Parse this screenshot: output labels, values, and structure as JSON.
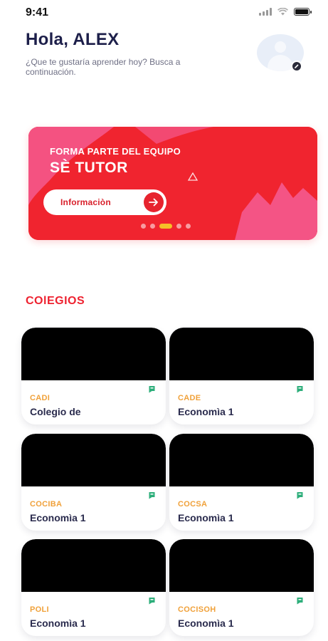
{
  "status_bar": {
    "time": "9:41"
  },
  "header": {
    "greeting": "Hola, ALEX",
    "subtitle": "¿Que te gustaría aprender hoy? Busca a continuación."
  },
  "banner": {
    "kicker": "FORMA PARTE DEL EQUIPO",
    "title": "SÈ TUTOR",
    "button_label": "Informaciòn",
    "slides": 5,
    "active_slide": 3,
    "colors": {
      "red": "#f0242f",
      "pink": "#f45a8f",
      "dot_active": "#f5c028"
    }
  },
  "section": {
    "title": "COlEGIOS"
  },
  "cards": [
    {
      "code": "CADI",
      "name": "Colegio de"
    },
    {
      "code": "CADE",
      "name": "Economìa 1"
    },
    {
      "code": "COCIBA",
      "name": "Economìa 1"
    },
    {
      "code": "COCSA",
      "name": "Economìa 1"
    },
    {
      "code": "POLI",
      "name": "Economìa 1"
    },
    {
      "code": "COCISOH",
      "name": "Economìa 1"
    }
  ],
  "colors": {
    "accent": "#ee2230",
    "code": "#f0a13a",
    "bookmark": "#2cae7a",
    "navy": "#1d1f4a"
  }
}
